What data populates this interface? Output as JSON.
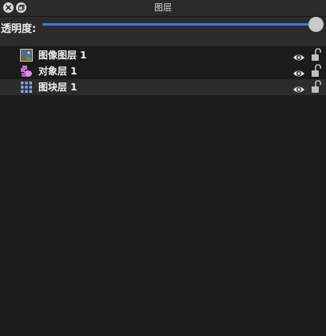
{
  "panel": {
    "title": "图层",
    "close_icon": "close-icon",
    "float_icon": "float-window-icon"
  },
  "opacity": {
    "label": "透明度:",
    "value_percent": 100
  },
  "layers": [
    {
      "name": "图像图层 1",
      "icon": "image-layer-icon",
      "visible": true,
      "locked": false,
      "selected": false
    },
    {
      "name": "对象层 1",
      "icon": "object-layer-icon",
      "visible": true,
      "locked": false,
      "selected": false
    },
    {
      "name": "图块层 1",
      "icon": "tile-layer-icon",
      "visible": true,
      "locked": false,
      "selected": true
    }
  ],
  "colors": {
    "accent": "#2f7de1",
    "background": "#1b1b1b",
    "toolbar": "#2b2b2b",
    "selected_row": "#2c2c2c"
  }
}
